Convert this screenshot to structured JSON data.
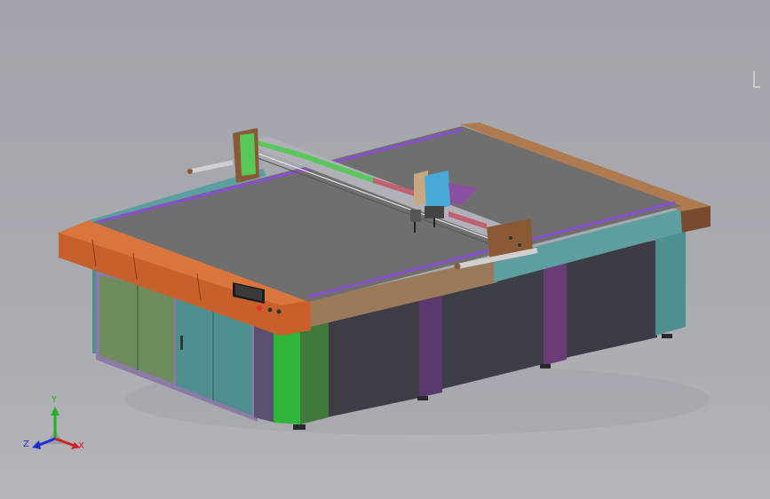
{
  "viewport": {
    "background": "#a6a8ae"
  },
  "model": {
    "name": "cnc-cutting-table",
    "colors": {
      "table_surface": "#6f6f70",
      "frame_orange": "#c8602c",
      "frame_tan": "#9a7a5a",
      "rail_purple": "#8a4fd0",
      "gantry_green": "#58c858",
      "gantry_gray": "#9a9aa2",
      "cabinet_green": "#6f8c5e",
      "cabinet_teal": "#4f8f90",
      "cabinet_dark": "#3e3c45",
      "cabinet_lavender": "#8d7aa6",
      "side_teal": "#5d9ea0",
      "panel_bright_green": "#2fb63a",
      "brown_plate": "#8a5a36",
      "head_blue": "#4aa8d8"
    }
  },
  "triad": {
    "x_label": "X",
    "y_label": "Y",
    "z_label": "Z",
    "x_color": "#d02020",
    "y_color": "#20b020",
    "z_color": "#2030d0"
  }
}
